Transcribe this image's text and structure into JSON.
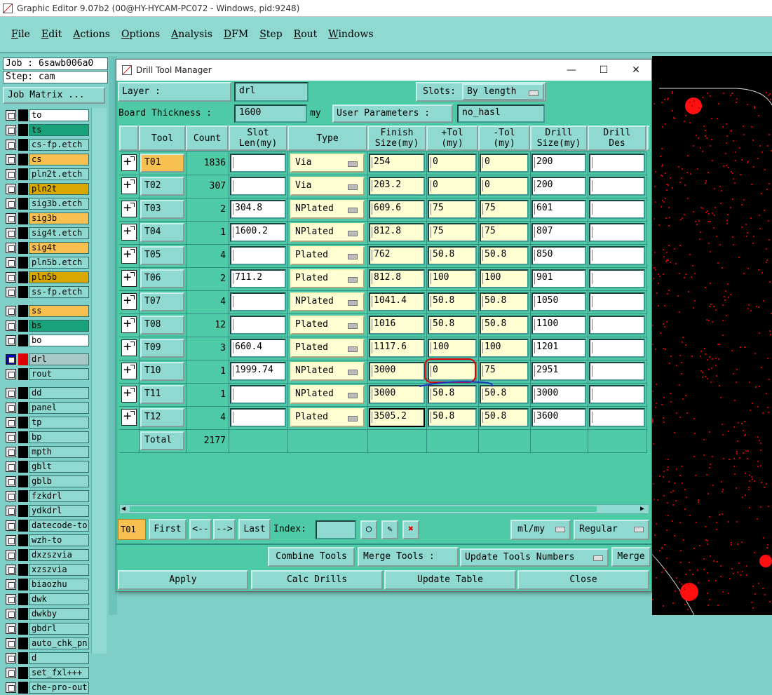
{
  "app": {
    "title": "Graphic Editor 9.07b2 (00@HY-HYCAM-PC072 - Windows, pid:9248)",
    "menu": [
      "File",
      "Edit",
      "Actions",
      "Options",
      "Analysis",
      "DFM",
      "Step",
      "Rout",
      "Windows"
    ]
  },
  "job": {
    "job_line": "Job : 6sawb006a0",
    "step_line": "Step: cam",
    "matrix_button": "Job Matrix ..."
  },
  "layers": [
    {
      "name": "to",
      "color": "#ffffff",
      "group": 1
    },
    {
      "name": "ts",
      "color": "#1aa37a",
      "group": 1
    },
    {
      "name": "cs-fp.etch",
      "color": "#8fd9d1",
      "group": 1
    },
    {
      "name": "cs",
      "color": "#f8c050",
      "group": 1
    },
    {
      "name": "pln2t.etch",
      "color": "#8fd9d1",
      "group": 1
    },
    {
      "name": "pln2t",
      "color": "#d8a800",
      "group": 1
    },
    {
      "name": "sig3b.etch",
      "color": "#8fd9d1",
      "group": 1
    },
    {
      "name": "sig3b",
      "color": "#f8c050",
      "group": 1
    },
    {
      "name": "sig4t.etch",
      "color": "#8fd9d1",
      "group": 1
    },
    {
      "name": "sig4t",
      "color": "#f8c050",
      "group": 1
    },
    {
      "name": "pln5b.etch",
      "color": "#8fd9d1",
      "group": 1
    },
    {
      "name": "pln5b",
      "color": "#d8a800",
      "group": 1
    },
    {
      "name": "ss-fp.etch",
      "color": "#8fd9d1",
      "group": 1
    },
    {
      "name": "ss",
      "color": "#f8c050",
      "group": 2
    },
    {
      "name": "bs",
      "color": "#1aa37a",
      "group": 2
    },
    {
      "name": "bo",
      "color": "#ffffff",
      "group": 2
    },
    {
      "name": "drl",
      "color": "#a8c8c8",
      "group": 3,
      "selected": true
    },
    {
      "name": "rout",
      "color": "#8fd9d1",
      "group": 3
    },
    {
      "name": "dd",
      "color": "#8fd9d1",
      "group": 4
    },
    {
      "name": "panel",
      "color": "#8fd9d1",
      "group": 4
    },
    {
      "name": "tp",
      "color": "#8fd9d1",
      "group": 4
    },
    {
      "name": "bp",
      "color": "#8fd9d1",
      "group": 4
    },
    {
      "name": "mpth",
      "color": "#8fd9d1",
      "group": 4
    },
    {
      "name": "gblt",
      "color": "#8fd9d1",
      "group": 4
    },
    {
      "name": "gblb",
      "color": "#8fd9d1",
      "group": 4
    },
    {
      "name": "fzkdrl",
      "color": "#8fd9d1",
      "group": 4
    },
    {
      "name": "ydkdrl",
      "color": "#8fd9d1",
      "group": 4
    },
    {
      "name": "datecode-to",
      "color": "#8fd9d1",
      "group": 4
    },
    {
      "name": "wzh-to",
      "color": "#8fd9d1",
      "group": 4
    },
    {
      "name": "dxzszvia",
      "color": "#8fd9d1",
      "group": 4
    },
    {
      "name": "xzszvia",
      "color": "#8fd9d1",
      "group": 4
    },
    {
      "name": "biaozhu",
      "color": "#8fd9d1",
      "group": 4
    },
    {
      "name": "dwk",
      "color": "#8fd9d1",
      "group": 4
    },
    {
      "name": "dwkby",
      "color": "#8fd9d1",
      "group": 4
    },
    {
      "name": "gbdrl",
      "color": "#8fd9d1",
      "group": 4
    },
    {
      "name": "auto_chk_pn.",
      "color": "#8fd9d1",
      "group": 4
    },
    {
      "name": "d",
      "color": "#8fd9d1",
      "group": 4
    },
    {
      "name": "set_fxl+++",
      "color": "#8fd9d1",
      "group": 4
    },
    {
      "name": "che-pro-out",
      "color": "#8fd9d1",
      "group": 4
    }
  ],
  "dialog": {
    "title": "Drill Tool Manager",
    "layer_label": "Layer           :",
    "layer_value": "drl",
    "slots_label": "Slots:",
    "slots_value": "By length",
    "board_thickness_label": "Board Thickness :",
    "board_thickness_value": "1600",
    "board_thickness_unit": "my",
    "user_params_label": "User Parameters :",
    "user_params_value": "no_hasl",
    "columns": [
      "Tool",
      "Count",
      "Slot\nLen(my)",
      "Type",
      "Finish\nSize(my)",
      "+Tol\n(my)",
      "-Tol\n(my)",
      "Drill\nSize(my)",
      "Drill\nDes"
    ],
    "rows": [
      {
        "tool": "T01",
        "count": "1836",
        "slot": "",
        "type": "Via",
        "finish": "254",
        "ptol": "0",
        "mtol": "0",
        "drill": "200",
        "des": ""
      },
      {
        "tool": "T02",
        "count": "307",
        "slot": "",
        "type": "Via",
        "finish": "203.2",
        "ptol": "0",
        "mtol": "0",
        "drill": "200",
        "des": ""
      },
      {
        "tool": "T03",
        "count": "2",
        "slot": "304.8",
        "type": "NPlated",
        "finish": "609.6",
        "ptol": "75",
        "mtol": "75",
        "drill": "601",
        "des": ""
      },
      {
        "tool": "T04",
        "count": "1",
        "slot": "1600.2",
        "type": "NPlated",
        "finish": "812.8",
        "ptol": "75",
        "mtol": "75",
        "drill": "807",
        "des": ""
      },
      {
        "tool": "T05",
        "count": "4",
        "slot": "",
        "type": "Plated",
        "finish": "762",
        "ptol": "50.8",
        "mtol": "50.8",
        "drill": "850",
        "des": ""
      },
      {
        "tool": "T06",
        "count": "2",
        "slot": "711.2",
        "type": "Plated",
        "finish": "812.8",
        "ptol": "100",
        "mtol": "100",
        "drill": "901",
        "des": ""
      },
      {
        "tool": "T07",
        "count": "4",
        "slot": "",
        "type": "NPlated",
        "finish": "1041.4",
        "ptol": "50.8",
        "mtol": "50.8",
        "drill": "1050",
        "des": ""
      },
      {
        "tool": "T08",
        "count": "12",
        "slot": "",
        "type": "Plated",
        "finish": "1016",
        "ptol": "50.8",
        "mtol": "50.8",
        "drill": "1100",
        "des": ""
      },
      {
        "tool": "T09",
        "count": "3",
        "slot": "660.4",
        "type": "Plated",
        "finish": "1117.6",
        "ptol": "100",
        "mtol": "100",
        "drill": "1201",
        "des": ""
      },
      {
        "tool": "T10",
        "count": "1",
        "slot": "1999.74",
        "type": "NPlated",
        "finish": "3000",
        "ptol": "0",
        "mtol": "75",
        "drill": "2951",
        "des": ""
      },
      {
        "tool": "T11",
        "count": "1",
        "slot": "",
        "type": "NPlated",
        "finish": "3000",
        "ptol": "50.8",
        "mtol": "50.8",
        "drill": "3000",
        "des": ""
      },
      {
        "tool": "T12",
        "count": "4",
        "slot": "",
        "type": "Plated",
        "finish": "3505.2",
        "ptol": "50.8",
        "mtol": "50.8",
        "drill": "3600",
        "des": ""
      }
    ],
    "total_label": "Total",
    "total_count": "2177",
    "current_tool": "T01",
    "nav": {
      "first": "First",
      "prev": "<--",
      "next": "-->",
      "last": "Last",
      "index_label": "Index:",
      "index_value": ""
    },
    "units": "ml/my",
    "mode": "Regular",
    "combine_tools": "Combine Tools",
    "merge_tools_label": "Merge Tools  :",
    "update_tools_numbers": "Update Tools Numbers",
    "merge": "Merge",
    "apply": "Apply",
    "calc_drills": "Calc Drills",
    "update_table": "Update Table",
    "close": "Close"
  },
  "colors": {
    "accent_teal": "#4ecaa6",
    "highlight": "#f8c050",
    "annotation_red": "#e00000",
    "annotation_blue": "#2030c0"
  }
}
